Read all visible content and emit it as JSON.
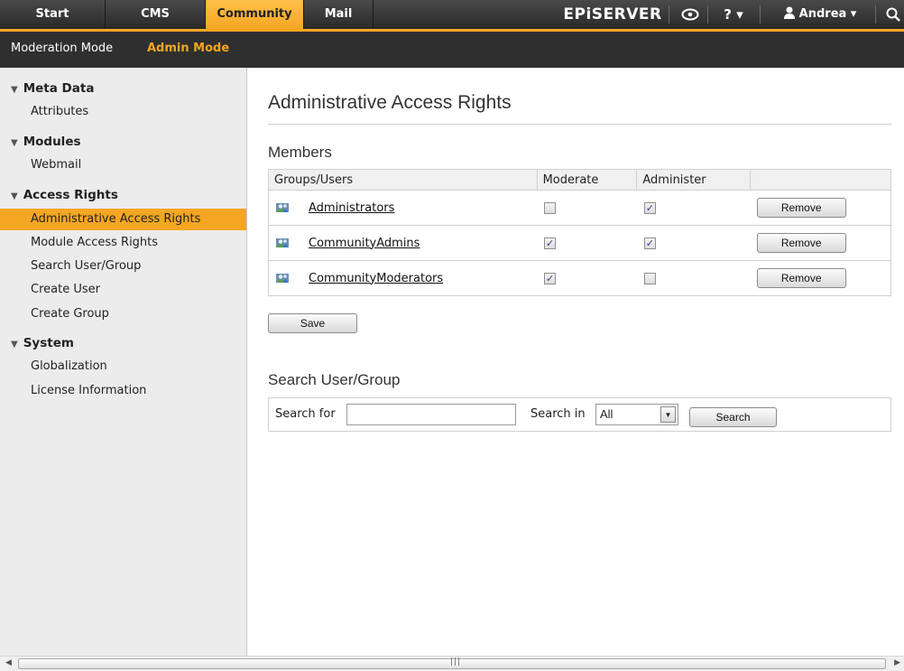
{
  "topnav": {
    "tabs": [
      {
        "label": "Start"
      },
      {
        "label": "CMS"
      },
      {
        "label": "Community"
      },
      {
        "label": "Mail"
      }
    ],
    "active_tab": "Community",
    "brand": "EPiSERVER",
    "help": "? ▾",
    "user": "Andrea ▾"
  },
  "subnav": {
    "modes": [
      {
        "label": "Moderation Mode"
      },
      {
        "label": "Admin Mode"
      }
    ],
    "active_mode": "Admin Mode"
  },
  "sidebar": {
    "groups": [
      {
        "title": "Meta Data",
        "items": [
          "Attributes"
        ]
      },
      {
        "title": "Modules",
        "items": [
          "Webmail"
        ]
      },
      {
        "title": "Access Rights",
        "items": [
          "Administrative Access Rights",
          "Module Access Rights",
          "Search User/Group",
          "Create User",
          "Create Group"
        ]
      },
      {
        "title": "System",
        "items": [
          "Globalization",
          "License Information"
        ]
      }
    ],
    "selected_item": "Administrative Access Rights"
  },
  "main": {
    "title": "Administrative Access Rights",
    "members": {
      "heading": "Members",
      "columns": [
        "Groups/Users",
        "Moderate",
        "Administer",
        ""
      ],
      "rows": [
        {
          "name": "Administrators",
          "moderate": false,
          "administer": true,
          "action": "Remove"
        },
        {
          "name": "CommunityAdmins",
          "moderate": true,
          "administer": true,
          "action": "Remove"
        },
        {
          "name": "CommunityModerators",
          "moderate": true,
          "administer": false,
          "action": "Remove"
        }
      ],
      "save_label": "Save"
    },
    "search": {
      "heading": "Search User/Group",
      "search_for_label": "Search for",
      "search_for_value": "",
      "search_in_label": "Search in",
      "search_in_value": "All",
      "button_label": "Search"
    }
  },
  "colors": {
    "accent": "#f5a623",
    "topbar": "#333333",
    "sidebar_bg": "#ececec"
  }
}
